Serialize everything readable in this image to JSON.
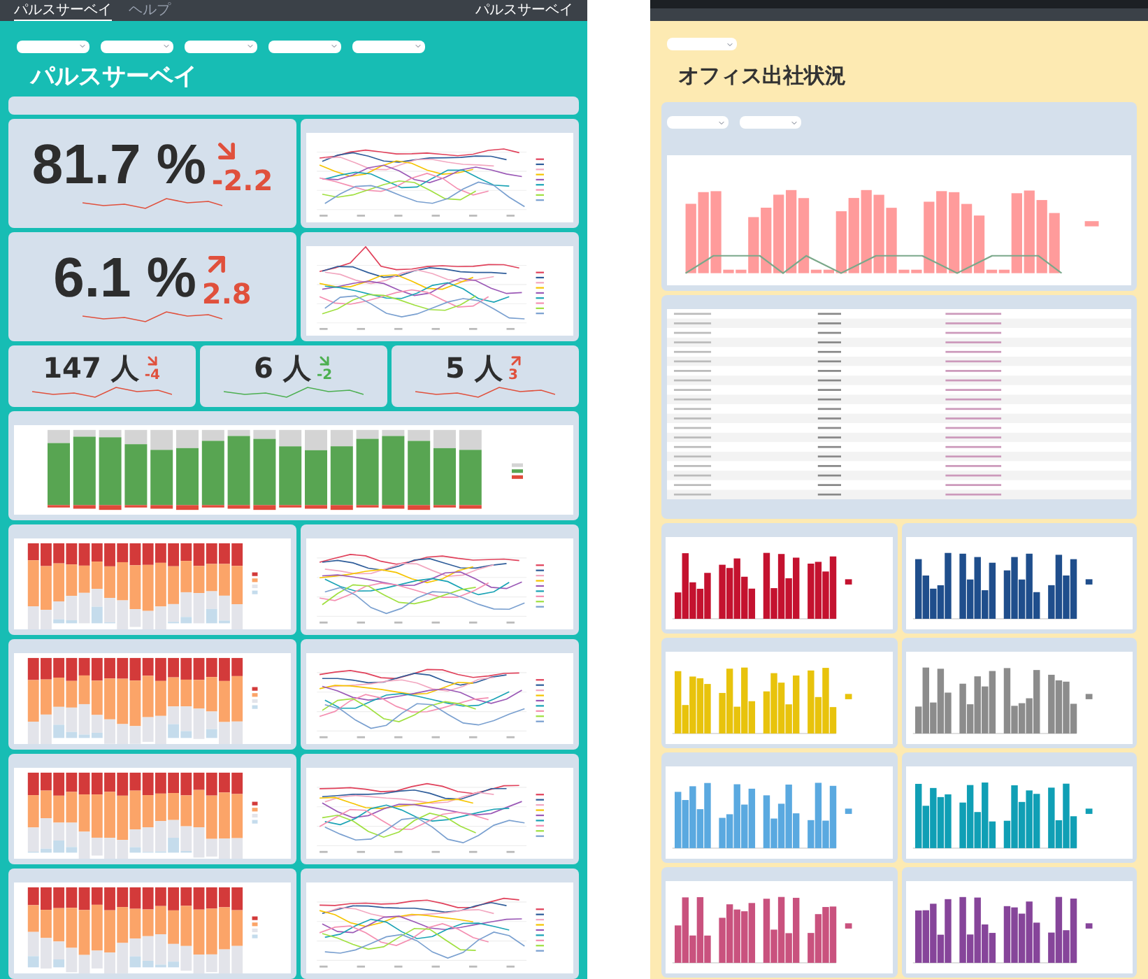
{
  "left": {
    "nav": {
      "tabs": [
        {
          "label": "パルスサーベイ",
          "selected": true
        },
        {
          "label": "ヘルプ",
          "selected": false
        }
      ],
      "brand": "パルスサーベイ"
    },
    "title": "パルスサーベイ",
    "kpis": [
      {
        "value": "81.7 %",
        "delta": "-2.2",
        "kind": "down",
        "color": "#e0503c"
      },
      {
        "value": "6.1 %",
        "delta": "2.8",
        "kind": "up",
        "color": "#e0503c"
      }
    ],
    "small_kpis": [
      {
        "value": "147 人",
        "delta": "-4",
        "kind": "down",
        "color": "#e0503c"
      },
      {
        "value": "6 人",
        "delta": "-2",
        "kind": "down",
        "color": "#4caf50"
      },
      {
        "value": "5 人",
        "delta": "3",
        "kind": "up",
        "color": "#e0503c"
      }
    ]
  },
  "right": {
    "title": "オフィス出社状況",
    "charts": [
      {
        "color": "#c4122f"
      },
      {
        "color": "#1f4e8c"
      },
      {
        "color": "#e8c30c"
      },
      {
        "color": "#8c8c8c"
      },
      {
        "color": "#5aa9e0"
      },
      {
        "color": "#109fb5"
      },
      {
        "color": "#c9527e"
      },
      {
        "color": "#86459a"
      }
    ]
  }
}
